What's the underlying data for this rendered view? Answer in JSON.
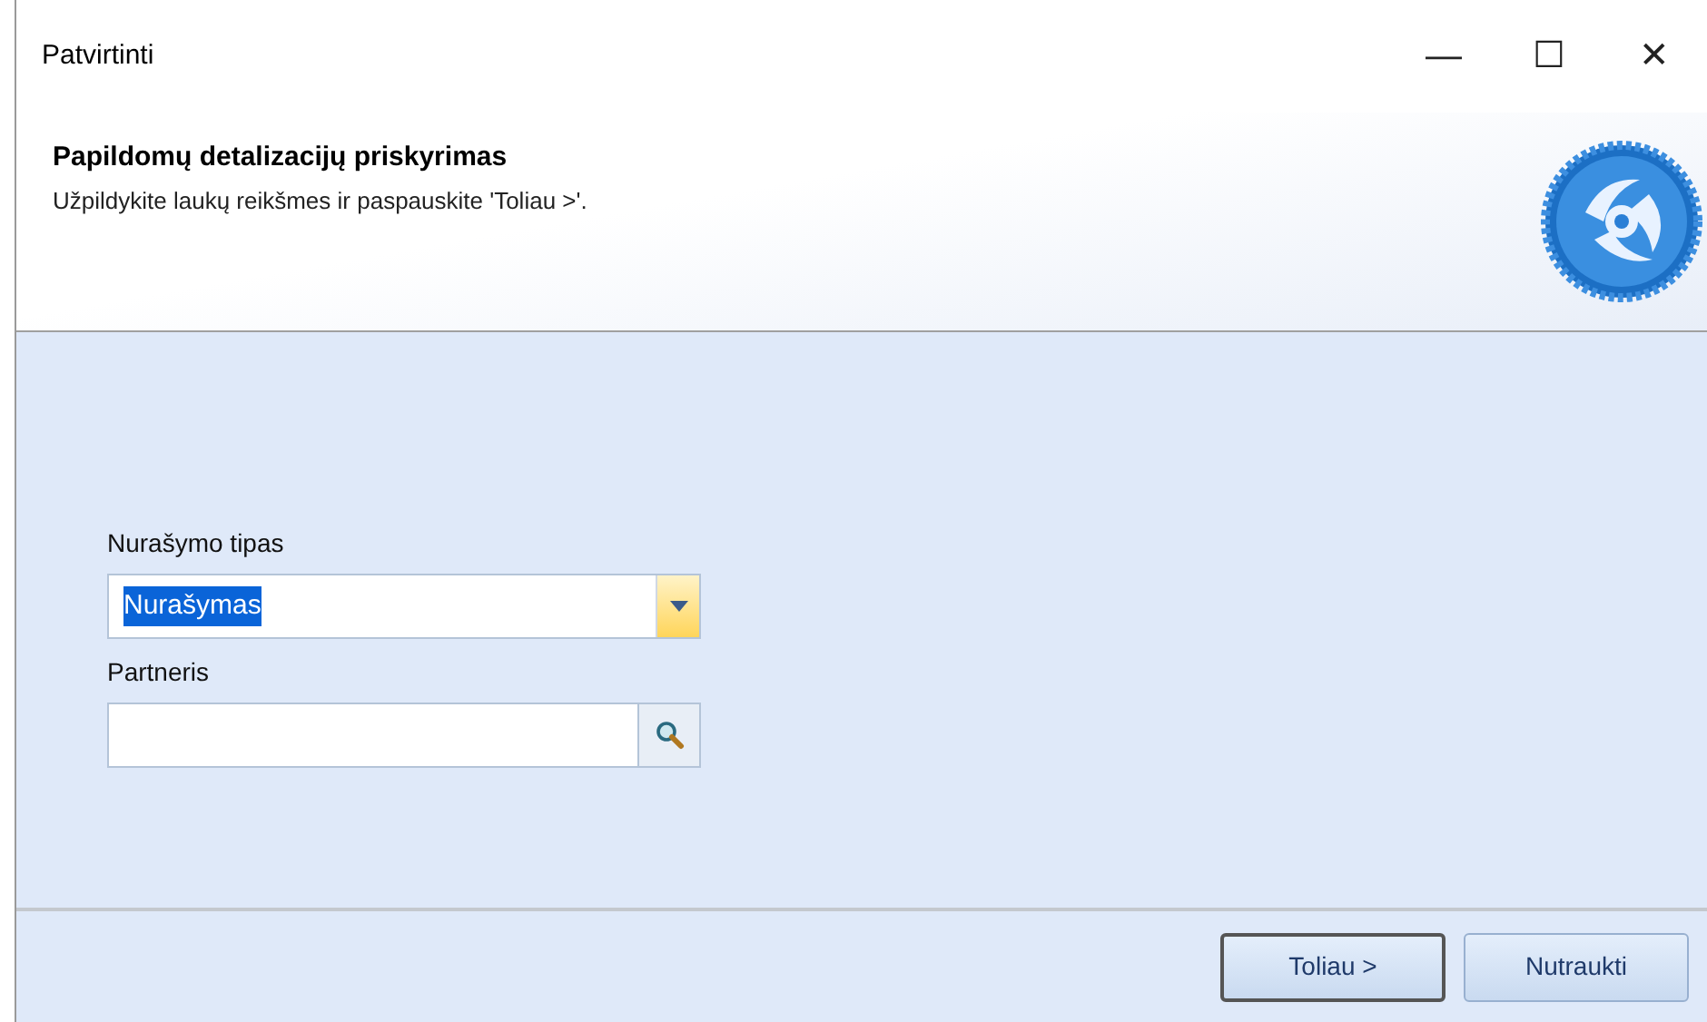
{
  "window": {
    "title": "Patvirtinti",
    "controls": [
      "—",
      "☐",
      "✕"
    ]
  },
  "header": {
    "title": "Papildomų detalizacijų priskyrimas",
    "subtitle": "Užpildykite laukų reikšmes ir paspauskite 'Toliau >'."
  },
  "fields": [
    {
      "kind": "dropdown",
      "label": "Nurašymo tipas",
      "value": "Nurašymas",
      "value_selected": true
    },
    {
      "kind": "lookup",
      "label": "Partneris"
    }
  ],
  "buttons": [
    {
      "label": "Toliau >",
      "default": true
    },
    {
      "label": "Nutraukti",
      "default": false
    }
  ]
}
